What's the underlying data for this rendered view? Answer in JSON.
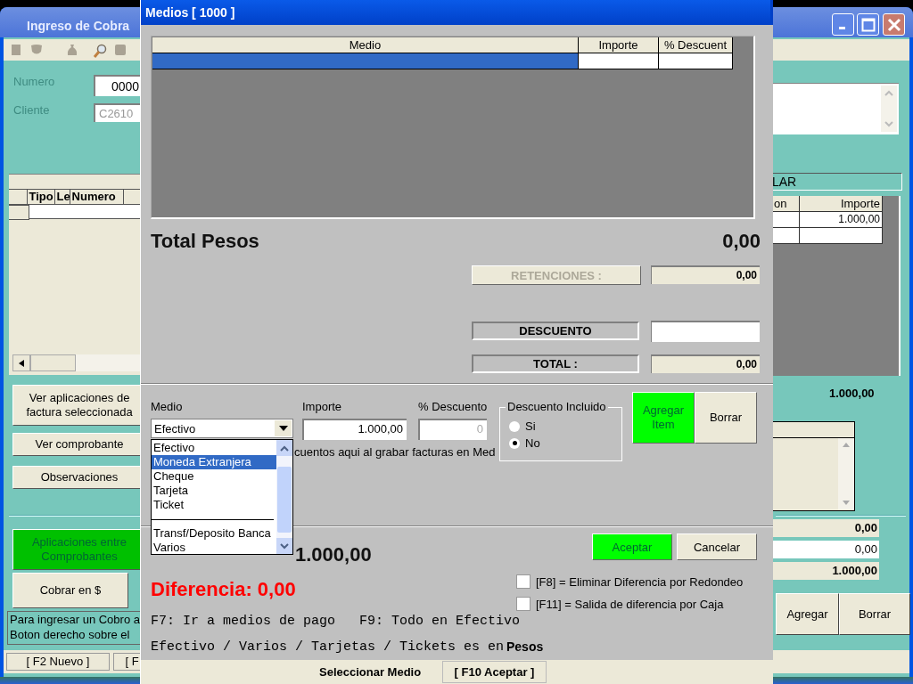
{
  "back_window": {
    "title": "Ingreso de Cobra",
    "fields": [
      {
        "label": "Numero",
        "value": "0000",
        "disabled": false
      },
      {
        "label": "Cliente",
        "value": "C2610",
        "disabled": true
      }
    ],
    "grid_columns": [
      "Tipo",
      "Le",
      "Numero"
    ],
    "side_buttons": [
      "Ver aplicaciones de factura seleccionada",
      "Ver comprobante",
      "Observaciones"
    ],
    "apps_button": "Aplicaciones entre Comprobantes",
    "cobrar_button": "Cobrar en $",
    "hint_lines": [
      "Para ingresar un Cobro a",
      "Boton derecho sobre el"
    ],
    "status_bar": [
      "[ F2 Nuevo ]",
      "[ F"
    ],
    "right": {
      "section_label": "LAR",
      "columns": [
        "on",
        "Importe"
      ],
      "rows": [
        [
          "",
          "1.000,00"
        ]
      ],
      "sum": "1.000,00",
      "totals": [
        {
          "value": "0,00",
          "kind": "readonly"
        },
        {
          "value": "0,00",
          "kind": "input"
        },
        {
          "value": "1.000,00",
          "kind": "readonly"
        }
      ],
      "buttons": [
        "Agregar",
        "Borrar"
      ]
    }
  },
  "dialog": {
    "title": "Medios [ 1000 ]",
    "grid": {
      "columns": [
        "Medio",
        "Importe",
        "% Descuent"
      ],
      "rows": [
        {
          "selected": true
        }
      ]
    },
    "total_pesos": {
      "label": "Total Pesos",
      "value": "0,00"
    },
    "retenciones": {
      "label": "RETENCIONES :",
      "value": "0,00",
      "disabled": true
    },
    "descuento": {
      "label": "DESCUENTO"
    },
    "total": {
      "label": "TOTAL :",
      "value": "0,00"
    },
    "medio": {
      "label": "Medio",
      "value": "Efectivo"
    },
    "importe": {
      "label": "Importe",
      "value": "1.000,00"
    },
    "porc_descuento": {
      "label": "% Descuento",
      "value": "0",
      "disabled": true
    },
    "descuento_incluido": {
      "label": "Descuento Incluido",
      "options": [
        {
          "label": "Si",
          "selected": false
        },
        {
          "label": "No",
          "selected": true
        }
      ]
    },
    "item_buttons": [
      {
        "label": "Agregar Item",
        "highlighted": true
      },
      {
        "label": "Borrar",
        "highlighted": false
      }
    ],
    "hidden_note": "cuentos aqui al grabar facturas en Med",
    "dropdown": [
      {
        "kind": "item",
        "label": "Efectivo",
        "selected": false
      },
      {
        "kind": "item",
        "label": "Moneda Extranjera",
        "selected": true
      },
      {
        "kind": "item",
        "label": "Cheque",
        "selected": false
      },
      {
        "kind": "item",
        "label": "Tarjeta",
        "selected": false
      },
      {
        "kind": "item",
        "label": "Ticket",
        "selected": false
      },
      {
        "kind": "separator"
      },
      {
        "kind": "item",
        "label": "Transf/Deposito Banca",
        "selected": false
      },
      {
        "kind": "item",
        "label": "Varios",
        "selected": false
      }
    ],
    "total_factura": "1.000,00",
    "diferencia": "Diferencia:  0,00",
    "buttons": [
      {
        "label": "Aceptar",
        "highlighted": true
      },
      {
        "label": "Cancelar",
        "highlighted": false
      }
    ],
    "checkboxes": [
      {
        "label": "[F8] = Eliminar Diferencia por Redondeo",
        "checked": false
      },
      {
        "label": "[F11] = Salida de diferencia por Caja",
        "checked": false
      }
    ],
    "hints": [
      "F7: Ir a medios de pago",
      "F9: Todo en Efectivo",
      "Efectivo / Varios / Tarjetas / Tickets es en"
    ],
    "currency": "Pesos",
    "status_bar": [
      "Seleccionar Medio",
      "[ F10 Aceptar ]"
    ]
  }
}
